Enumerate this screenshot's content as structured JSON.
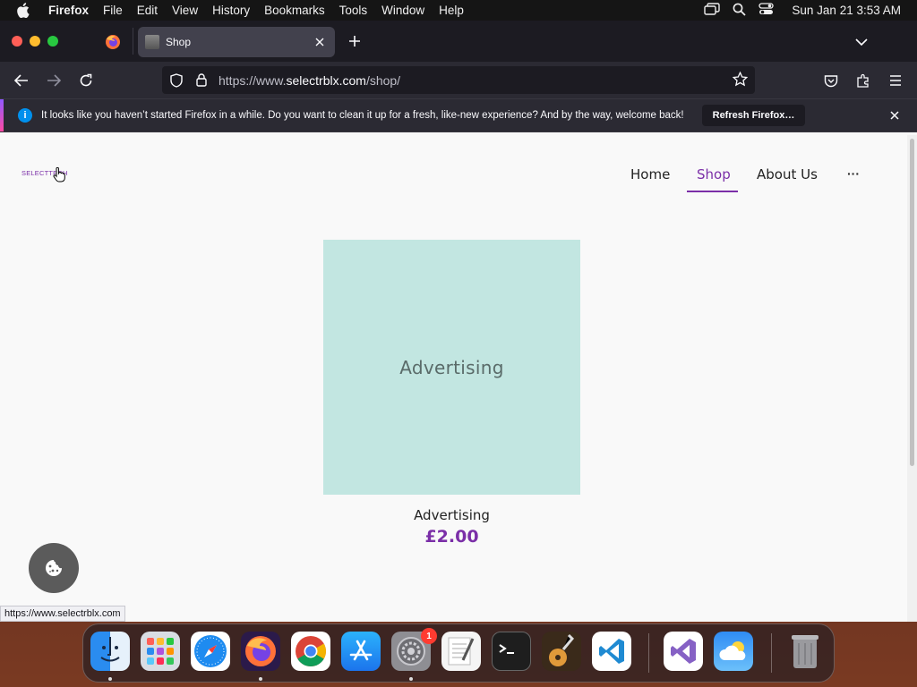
{
  "menubar": {
    "app_name": "Firefox",
    "items": [
      "File",
      "Edit",
      "View",
      "History",
      "Bookmarks",
      "Tools",
      "Window",
      "Help"
    ],
    "clock": "Sun Jan 21  3:53 AM"
  },
  "browser": {
    "active_tab_title": "Shop",
    "url_prefix": "https://www.",
    "url_domain": "selectrblx.com",
    "url_path": "/shop/",
    "notice_text": "It looks like you haven’t started Firefox in a while. Do you want to clean it up for a fresh, like-new experience? And by the way, welcome back!",
    "notice_button": "Refresh Firefox…",
    "status_url": "https://www.selectrblx.com"
  },
  "site": {
    "logo_text": "SELECTTECH",
    "nav": [
      "Home",
      "Shop",
      "About Us"
    ],
    "active_nav": "Shop",
    "more_label": "···",
    "product": {
      "image_text": "Advertising",
      "name": "Advertising",
      "price": "£2.00"
    }
  },
  "dock": {
    "apps": [
      "finder",
      "launchpad",
      "safari",
      "firefox",
      "chrome",
      "app-store",
      "system-settings",
      "textedit",
      "terminal",
      "garageband",
      "vscode",
      "visual-studio",
      "weather",
      "trash"
    ],
    "system_settings_badge": "1"
  },
  "colors": {
    "accent": "#7b2fa8",
    "product_image_bg": "#c2e6e1"
  }
}
